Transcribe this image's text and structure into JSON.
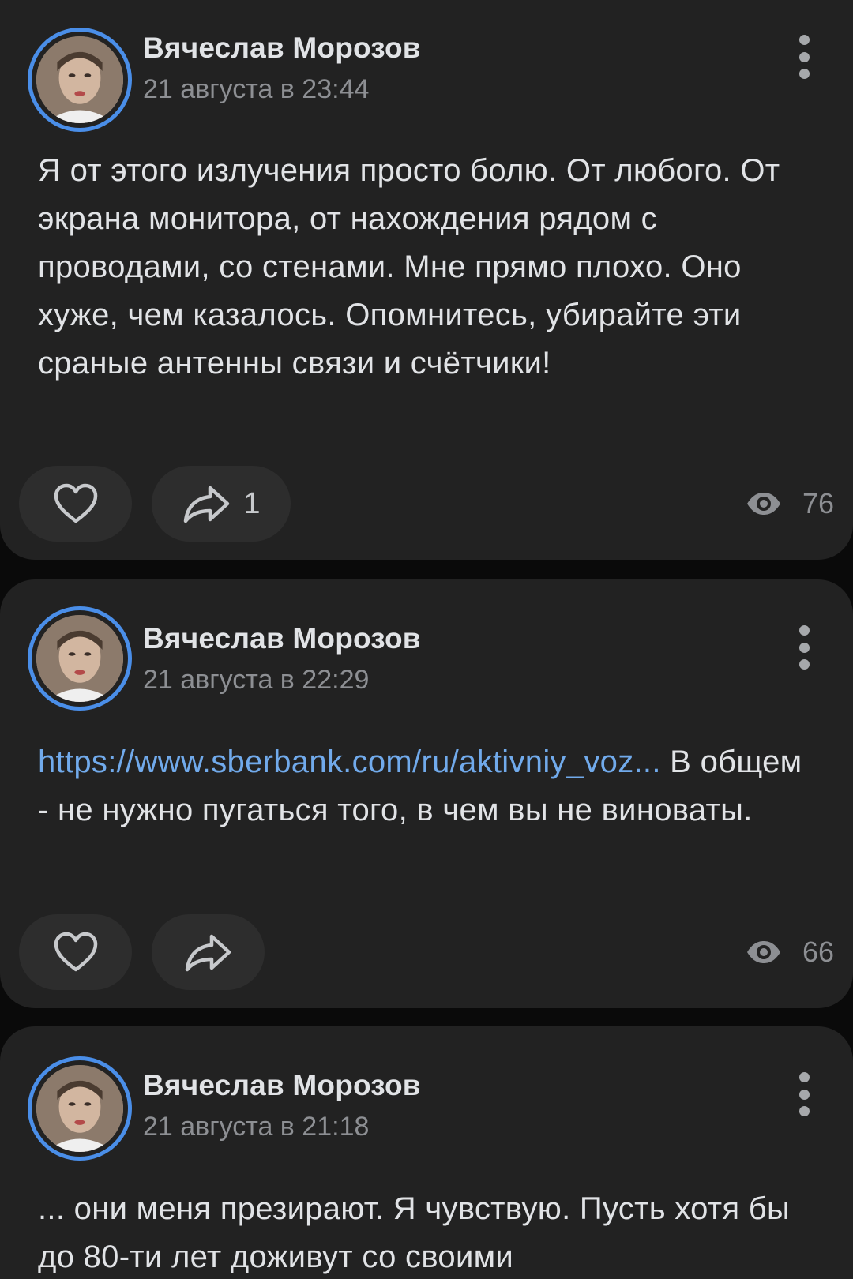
{
  "posts": [
    {
      "author": "Вячеслав Морозов",
      "time": "21 августа в 23:44",
      "text": "Я от этого излучения просто болю. От любого. От экрана монитора, от нахождения рядом с проводами, со стенами. Мне прямо плохо. Оно хуже, чем казалось. Опомнитесь, убирайте эти сраные антенны связи и счётчики!",
      "link": "",
      "share_count": "1",
      "views": "76"
    },
    {
      "author": "Вячеслав Морозов",
      "time": "21 августа в 22:29",
      "link": "https://www.sberbank.com/ru/aktivniy_voz...",
      "text": " В общем - не нужно пугаться того, в чем вы не виноваты.",
      "share_count": "",
      "views": "66"
    },
    {
      "author": "Вячеслав Морозов",
      "time": "21 августа в 21:18",
      "text": "... они меня презирают. Я чувствую. Пусть хотя бы до 80-ти лет доживут со своими",
      "link": "",
      "share_count": "",
      "views": ""
    }
  ],
  "icons": {
    "more": "more-vertical-icon",
    "like": "heart-icon",
    "share": "share-arrow-icon",
    "views": "eye-icon"
  },
  "colors": {
    "background": "#0a0a0a",
    "card": "#222222",
    "pill": "#2d2d2d",
    "avatar_ring": "#4a8ee8",
    "link": "#71aaeb",
    "secondary_text": "#8d8f93"
  }
}
